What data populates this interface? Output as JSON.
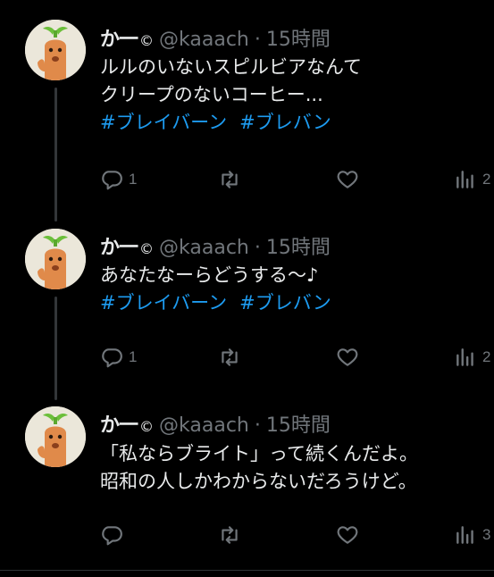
{
  "tweets": [
    {
      "name": "か一",
      "badge": "©",
      "handle": "@kaaach",
      "separator": "·",
      "time": "15時間",
      "lines": [
        "ルルのいないスピルビアなんて",
        "クリープのないコーヒー..."
      ],
      "hashtags": [
        "#ブレイバーン",
        "#ブレバン"
      ],
      "reply_count": "1",
      "views_count": "2"
    },
    {
      "name": "か一",
      "badge": "©",
      "handle": "@kaaach",
      "separator": "·",
      "time": "15時間",
      "lines": [
        "あなたなーらどうする〜♪"
      ],
      "hashtags": [
        "#ブレイバーン",
        "#ブレバン"
      ],
      "reply_count": "1",
      "views_count": "2"
    },
    {
      "name": "か一",
      "badge": "©",
      "handle": "@kaaach",
      "separator": "·",
      "time": "15時間",
      "lines": [
        "「私ならブライト」って続くんだよ。",
        "昭和の人しかわからないだろうけど。"
      ],
      "hashtags": [],
      "reply_count": "",
      "views_count": "3"
    }
  ],
  "icons": {
    "reply": "reply-icon",
    "retweet": "retweet-icon",
    "like": "heart-icon",
    "views": "views-bar-chart-icon"
  },
  "colors": {
    "background": "#000000",
    "text": "#e7e9ea",
    "secondary": "#71767b",
    "hashtag": "#1d9bf0",
    "thread_line": "#333639"
  }
}
